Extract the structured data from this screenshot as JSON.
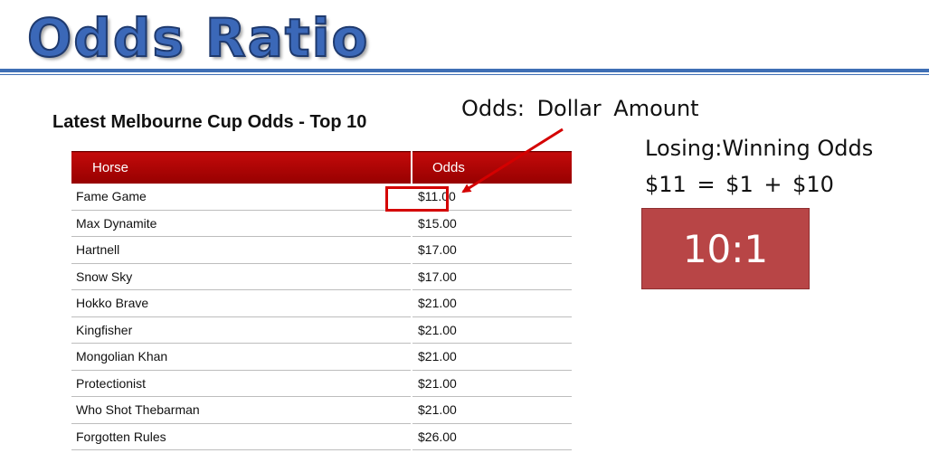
{
  "slide": {
    "title": "Odds Ratio"
  },
  "table": {
    "title": "Latest Melbourne Cup Odds - Top 10",
    "headers": {
      "horse": "Horse",
      "odds": "Odds"
    },
    "rows": [
      {
        "horse": "Fame Game",
        "odds": "$11.00"
      },
      {
        "horse": "Max Dynamite",
        "odds": "$15.00"
      },
      {
        "horse": "Hartnell",
        "odds": "$17.00"
      },
      {
        "horse": "Snow Sky",
        "odds": "$17.00"
      },
      {
        "horse": "Hokko Brave",
        "odds": "$21.00"
      },
      {
        "horse": "Kingfisher",
        "odds": "$21.00"
      },
      {
        "horse": "Mongolian Khan",
        "odds": "$21.00"
      },
      {
        "horse": "Protectionist",
        "odds": "$21.00"
      },
      {
        "horse": "Who Shot Thebarman",
        "odds": "$21.00"
      },
      {
        "horse": "Forgotten Rules",
        "odds": "$26.00"
      }
    ]
  },
  "annotations": {
    "odds_label": "Odds: Dollar Amount",
    "losing_winning": "Losing:Winning Odds",
    "equation": "$11 = $1 + $10",
    "ratio": "10:1"
  },
  "colors": {
    "title_blue": "#3b68b8",
    "header_red": "#b00000",
    "highlight_red": "#d40000",
    "ratio_box": "#b84546"
  },
  "icons": {
    "arrow": "red-arrow-icon"
  }
}
